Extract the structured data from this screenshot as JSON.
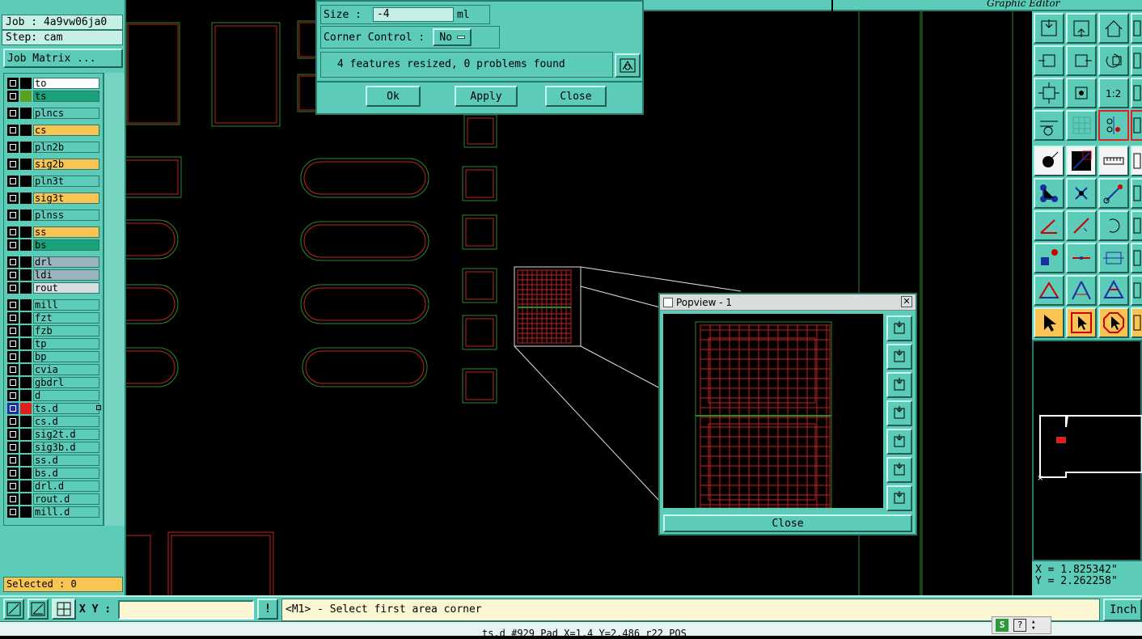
{
  "app": {
    "title_fragment": "Graphic Editor"
  },
  "job": {
    "job_label": "Job : 4a9vw06ja0",
    "step_label": "Step: cam",
    "matrix_button": "Job Matrix ..."
  },
  "layers": [
    {
      "name": "to",
      "color": "#ffffff",
      "swatch": "#000000"
    },
    {
      "name": "ts",
      "color": "#1aa37a",
      "swatch": "#5aa020"
    },
    {
      "name": "plncs",
      "color": "#5ccbb7",
      "swatch": "#000000"
    },
    {
      "name": "cs",
      "color": "#f8c454",
      "swatch": "#000000"
    },
    {
      "name": "pln2b",
      "color": "#5ccbb7",
      "swatch": "#000000"
    },
    {
      "name": "sig2b",
      "color": "#f8c454",
      "swatch": "#000000"
    },
    {
      "name": "pln3t",
      "color": "#5ccbb7",
      "swatch": "#000000"
    },
    {
      "name": "sig3t",
      "color": "#f8c454",
      "swatch": "#000000"
    },
    {
      "name": "plnss",
      "color": "#5ccbb7",
      "swatch": "#000000"
    },
    {
      "name": "ss",
      "color": "#f8c454",
      "swatch": "#000000"
    },
    {
      "name": "bs",
      "color": "#1aa37a",
      "swatch": "#000000"
    },
    {
      "name": "drl",
      "color": "#9ab3bd",
      "swatch": "#000000"
    },
    {
      "name": "ldi",
      "color": "#9ab3bd",
      "swatch": "#000000"
    },
    {
      "name": "rout",
      "color": "#d8dede",
      "swatch": "#000000"
    },
    {
      "name": "mill",
      "color": "#5ccbb7",
      "swatch": "#000000"
    },
    {
      "name": "fzt",
      "color": "#5ccbb7",
      "swatch": "#000000"
    },
    {
      "name": "fzb",
      "color": "#5ccbb7",
      "swatch": "#000000"
    },
    {
      "name": "tp",
      "color": "#5ccbb7",
      "swatch": "#000000"
    },
    {
      "name": "bp",
      "color": "#5ccbb7",
      "swatch": "#000000"
    },
    {
      "name": "cvia",
      "color": "#5ccbb7",
      "swatch": "#000000"
    },
    {
      "name": "gbdrl",
      "color": "#5ccbb7",
      "swatch": "#000000"
    },
    {
      "name": "d",
      "color": "#5ccbb7",
      "swatch": "#000000"
    },
    {
      "name": "ts.d",
      "color": "#5ccbb7",
      "swatch": "#e02020",
      "active": true
    },
    {
      "name": "cs.d",
      "color": "#5ccbb7",
      "swatch": "#000000"
    },
    {
      "name": "sig2t.d",
      "color": "#5ccbb7",
      "swatch": "#000000"
    },
    {
      "name": "sig3b.d",
      "color": "#5ccbb7",
      "swatch": "#000000"
    },
    {
      "name": "ss.d",
      "color": "#5ccbb7",
      "swatch": "#000000"
    },
    {
      "name": "bs.d",
      "color": "#5ccbb7",
      "swatch": "#000000"
    },
    {
      "name": "drl.d",
      "color": "#5ccbb7",
      "swatch": "#000000"
    },
    {
      "name": "rout.d",
      "color": "#5ccbb7",
      "swatch": "#000000"
    },
    {
      "name": "mill.d",
      "color": "#5ccbb7",
      "swatch": "#000000"
    }
  ],
  "selected": "Selected : 0",
  "resize_dialog": {
    "size_label": "Size :",
    "size_value": "-4",
    "size_unit": "ml",
    "corner_label": "Corner Control :",
    "corner_value": "No",
    "result_text": "4 features resized, 0 problems found",
    "ok": "Ok",
    "apply": "Apply",
    "close": "Close"
  },
  "popview": {
    "title": "Popview - 1",
    "close": "Close"
  },
  "coords": {
    "x": "X = 1.825342\"",
    "y": "Y = 2.262258\""
  },
  "bottom": {
    "xy_label": "X Y :",
    "xy_value": "",
    "prompt": "<M1> - Select first area corner",
    "units": "Inch"
  },
  "status": {
    "text": "ts.d #929 Pad X=1.4 Y=2.486 r22 POS"
  }
}
